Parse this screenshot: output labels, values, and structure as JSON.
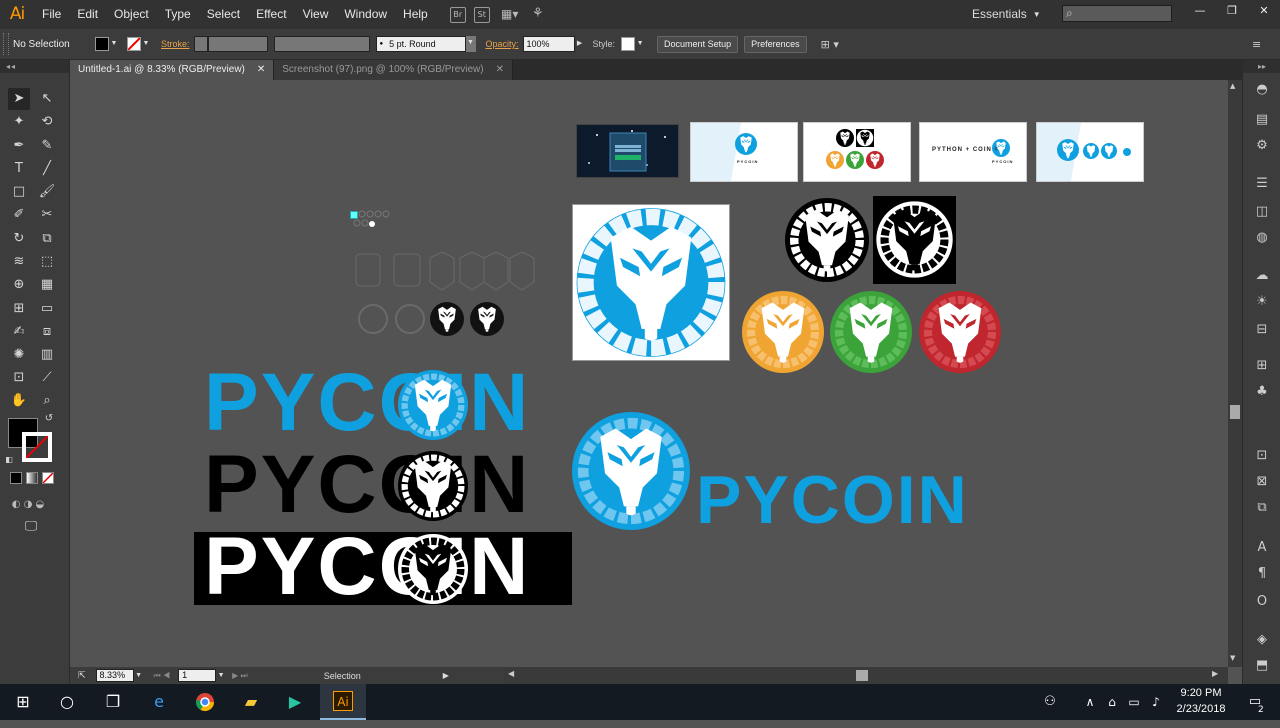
{
  "app": {
    "logo": "Ai"
  },
  "menu": [
    "File",
    "Edit",
    "Object",
    "Type",
    "Select",
    "Effect",
    "View",
    "Window",
    "Help"
  ],
  "menubar_icons": [
    "Br",
    "St",
    "▦▾",
    "⚘"
  ],
  "workspace": {
    "label": "Essentials"
  },
  "control_bar": {
    "selection": "No Selection",
    "stroke_label": "Stroke:",
    "brush": "5 pt. Round",
    "opacity_label": "Opacity:",
    "opacity_value": "100%",
    "style_label": "Style:",
    "doc_setup": "Document Setup",
    "preferences": "Preferences"
  },
  "tabs": [
    {
      "label": "Untitled-1.ai @ 8.33% (RGB/Preview)",
      "active": true
    },
    {
      "label": "Screenshot (97).png @ 100% (RGB/Preview)",
      "active": false
    }
  ],
  "artboard": {
    "wordmark": "PYCOIN",
    "thumb_text_1": "PYCOIN",
    "thumb_text_2": "PYTHON + COIN =",
    "thumb_text_3": "PYCOIN",
    "colors": {
      "blue": "#0fa0e0",
      "black": "#000000",
      "white": "#ffffff",
      "orange": "#f0a533",
      "green": "#3ba33a",
      "red": "#c0262d"
    }
  },
  "status": {
    "zoom": "8.33%",
    "page": "1",
    "tool": "Selection"
  },
  "taskbar": {
    "time": "9:20 PM",
    "date": "2/23/2018",
    "notifications": "2"
  }
}
